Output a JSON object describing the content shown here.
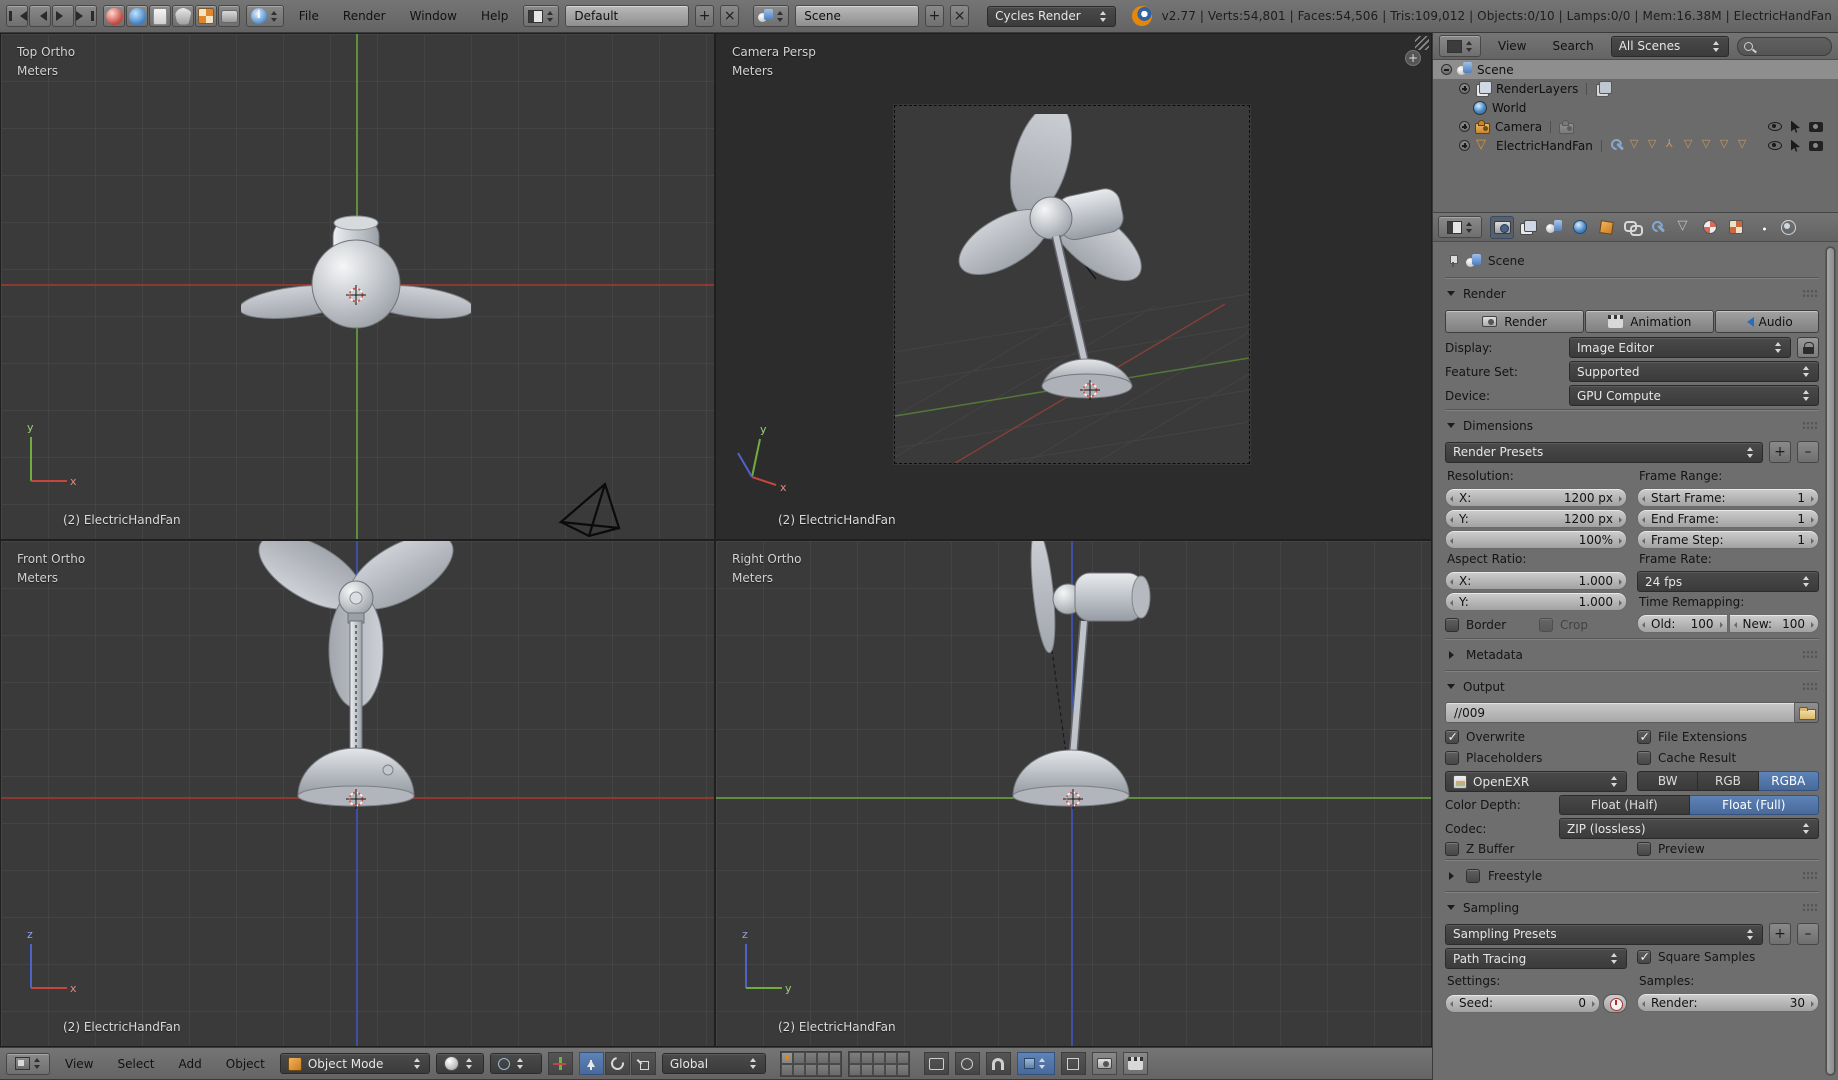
{
  "topbar": {
    "menus": [
      "File",
      "Render",
      "Window",
      "Help"
    ],
    "layout_name": "Default",
    "scene_name": "Scene",
    "engine": "Cycles Render",
    "stats": "v2.77 | Verts:54,801 | Faces:54,506 | Tris:109,012 | Objects:0/10 | Lamps:0/0 | Mem:16.38M | ElectricHandFan"
  },
  "viewports": {
    "top": {
      "label": "Top Ortho",
      "unit": "Meters",
      "object_name": "(2) ElectricHandFan",
      "axis_up": "y",
      "axis_right": "x"
    },
    "camera": {
      "label": "Camera Persp",
      "unit": "Meters",
      "object_name": "(2) ElectricHandFan",
      "axis_up": "y",
      "axis_right": "x"
    },
    "front": {
      "label": "Front Ortho",
      "unit": "Meters",
      "object_name": "(2) ElectricHandFan",
      "axis_up": "z",
      "axis_right": "x"
    },
    "side": {
      "label": "Right Ortho",
      "unit": "Meters",
      "object_name": "(2) ElectricHandFan",
      "axis_up": "z",
      "axis_right": "y"
    }
  },
  "bottombar": {
    "menus": [
      "View",
      "Select",
      "Add",
      "Object"
    ],
    "mode": "Object Mode",
    "orientation": "Global"
  },
  "outliner": {
    "view_menu": "View",
    "search_menu": "Search",
    "filter": "All Scenes",
    "items": [
      "Scene",
      "RenderLayers",
      "World",
      "Camera",
      "ElectricHandFan"
    ]
  },
  "properties": {
    "breadcrumb": "Scene",
    "render": {
      "title": "Render",
      "render_btn": "Render",
      "animation_btn": "Animation",
      "audio_btn": "Audio",
      "display_label": "Display:",
      "display_value": "Image Editor",
      "feature_label": "Feature Set:",
      "feature_value": "Supported",
      "device_label": "Device:",
      "device_value": "GPU Compute"
    },
    "dimensions": {
      "title": "Dimensions",
      "presets": "Render Presets",
      "resolution_label": "Resolution:",
      "res_x_label": "X:",
      "res_x": "1200 px",
      "res_y_label": "Y:",
      "res_y": "1200 px",
      "res_scale": "100%",
      "frame_range_label": "Frame Range:",
      "start_label": "Start Frame:",
      "start": "1",
      "end_label": "End Frame:",
      "end": "1",
      "step_label": "Frame Step:",
      "step": "1",
      "aspect_label": "Aspect Ratio:",
      "asp_x_label": "X:",
      "asp_x": "1.000",
      "asp_y_label": "Y:",
      "asp_y": "1.000",
      "border": "Border",
      "crop": "Crop",
      "frame_rate_label": "Frame Rate:",
      "fps": "24 fps",
      "remap_label": "Time Remapping:",
      "old_label": "Old:",
      "old": "100",
      "new_label": "New:",
      "new": "100"
    },
    "metadata": {
      "title": "Metadata"
    },
    "output": {
      "title": "Output",
      "path": "//009",
      "overwrite": "Overwrite",
      "file_extensions": "File Extensions",
      "placeholders": "Placeholders",
      "cache_result": "Cache Result",
      "format": "OpenEXR",
      "bw": "BW",
      "rgb": "RGB",
      "rgba": "RGBA",
      "depth_label": "Color Depth:",
      "half": "Float (Half)",
      "full": "Float (Full)",
      "codec_label": "Codec:",
      "codec": "ZIP (lossless)",
      "zbuffer": "Z Buffer",
      "preview": "Preview"
    },
    "freestyle": {
      "title": "Freestyle"
    },
    "sampling": {
      "title": "Sampling",
      "presets": "Sampling Presets",
      "integrator": "Path Tracing",
      "square_samples": "Square Samples",
      "settings_label": "Settings:",
      "seed_label": "Seed:",
      "seed": "0",
      "samples_label": "Samples:",
      "render_label": "Render:",
      "render": "30"
    }
  },
  "colors": {
    "accent_blue": "#5d83b7",
    "blender_orange": "#e8860c",
    "axis_x_red": "#c4463f",
    "axis_y_green": "#6fae3e",
    "axis_z_blue": "#3e50ac"
  },
  "icons": {
    "search": "magnifier",
    "visibility": "eye",
    "selectability": "cursor-arrow",
    "renderability": "camera"
  }
}
